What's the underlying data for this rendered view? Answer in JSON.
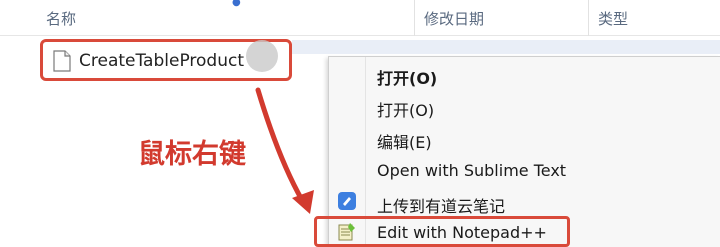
{
  "columns": {
    "name": "名称",
    "modified": "修改日期",
    "type": "类型"
  },
  "file": {
    "name": "CreateTableProduct",
    "icon": "document-icon"
  },
  "context_menu": {
    "items": [
      {
        "label": "打开(O)",
        "bold": true
      },
      {
        "label": "打开(O)"
      },
      {
        "label": "编辑(E)"
      },
      {
        "label": "Open with Sublime Text"
      },
      {
        "label": "上传到有道云笔记",
        "icon": "youdao-note-icon"
      },
      {
        "label": "Edit with Notepad++",
        "icon": "notepadpp-icon"
      }
    ]
  },
  "annotation": {
    "text": "鼠标右键"
  },
  "colors": {
    "highlight_red": "#d94a3a",
    "annotation_red": "#d23a2e",
    "header_text": "#5a6a80",
    "menu_bg": "#f7f7f7"
  }
}
